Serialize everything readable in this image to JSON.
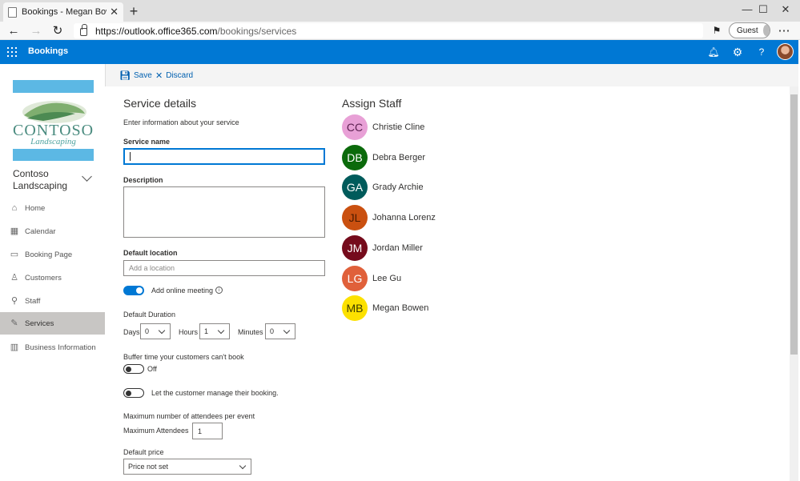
{
  "browser": {
    "tab_title": "Bookings - Megan Bowen - Outl",
    "tab_close": "✕",
    "new_tab": "+",
    "url_host": "https://outlook.office365.com",
    "url_path": "/bookings/services",
    "guest_label": "Guest",
    "minimize": "—",
    "maximize": "☐",
    "close": "✕"
  },
  "app": {
    "title": "Bookings",
    "accent": "#0078d4"
  },
  "sidebar": {
    "logo_name": "CONTOSO",
    "logo_sub": "Landscaping",
    "business_line1": "Contoso",
    "business_line2": "Landscaping",
    "items": [
      {
        "label": "Home",
        "icon": "home-icon",
        "glyph": "⌂"
      },
      {
        "label": "Calendar",
        "icon": "calendar-icon",
        "glyph": "▦"
      },
      {
        "label": "Booking Page",
        "icon": "monitor-icon",
        "glyph": "▭"
      },
      {
        "label": "Customers",
        "icon": "person-icon",
        "glyph": "♙"
      },
      {
        "label": "Staff",
        "icon": "staff-icon",
        "glyph": "⚲"
      },
      {
        "label": "Services",
        "icon": "wrench-icon",
        "glyph": "✎",
        "active": true
      },
      {
        "label": "Business Information",
        "icon": "building-icon",
        "glyph": "▥"
      }
    ]
  },
  "toolbar": {
    "save_label": "Save",
    "discard_label": "Discard"
  },
  "form": {
    "title": "Service details",
    "intro": "Enter information about your service",
    "service_name_label": "Service name",
    "service_name_value": "",
    "description_label": "Description",
    "default_location_label": "Default location",
    "location_placeholder": "Add a location",
    "online_meeting_label": "Add online meeting",
    "online_meeting_on": true,
    "duration_label": "Default Duration",
    "days_label": "Days",
    "days_value": "0",
    "hours_label": "Hours",
    "hours_value": "1",
    "minutes_label": "Minutes",
    "minutes_value": "0",
    "buffer_label": "Buffer time your customers can't book",
    "buffer_state": "Off",
    "manage_label": "Let the customer manage their booking.",
    "max_attendees_heading": "Maximum number of attendees per event",
    "max_attendees_label": "Maximum Attendees",
    "max_attendees_value": "1",
    "price_label": "Default price",
    "price_value": "Price not set"
  },
  "staff": {
    "title": "Assign Staff",
    "members": [
      {
        "initials": "CC",
        "name": "Christie Cline",
        "color": "#e8a0d6",
        "text": "#5a1f4f"
      },
      {
        "initials": "DB",
        "name": "Debra Berger",
        "color": "#0b6a0b",
        "text": "#ffffff"
      },
      {
        "initials": "GA",
        "name": "Grady Archie",
        "color": "#005b5b",
        "text": "#ffffff"
      },
      {
        "initials": "JL",
        "name": "Johanna Lorenz",
        "color": "#ca5010",
        "text": "#4a1a00"
      },
      {
        "initials": "JM",
        "name": "Jordan Miller",
        "color": "#750b1c",
        "text": "#ffffff"
      },
      {
        "initials": "LG",
        "name": "Lee Gu",
        "color": "#e0603a",
        "text": "#ffffff"
      },
      {
        "initials": "MB",
        "name": "Megan Bowen",
        "color": "#fce100",
        "text": "#3b3a00"
      }
    ]
  }
}
